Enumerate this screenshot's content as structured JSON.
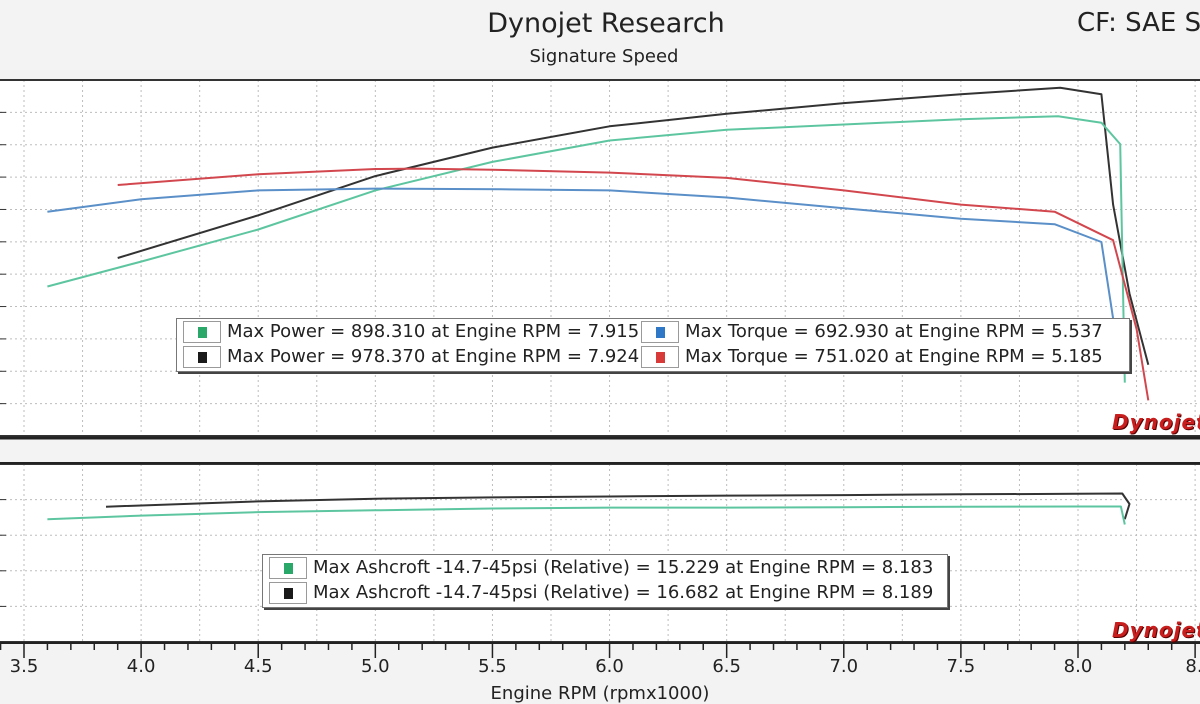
{
  "header": {
    "title": "Dynojet Research",
    "subtitle": "Signature Speed",
    "correction": "CF: SAE S"
  },
  "logo_text": "Dynojet",
  "colors": {
    "green": "#2aa86a",
    "black": "#1a1a1a",
    "blue": "#2f78c8",
    "red": "#d83a3a",
    "green_line": "#5dc6a0",
    "black_line": "#333333",
    "blue_line": "#5a8fc8",
    "red_line": "#d2474e"
  },
  "legend_top": {
    "left": [
      {
        "text": "Max Power = 898.310 at Engine RPM = 7.915",
        "color": "green"
      },
      {
        "text": "Max Power = 978.370 at Engine RPM = 7.924",
        "color": "black"
      }
    ],
    "right": [
      {
        "text": "Max Torque = 692.930 at Engine RPM = 5.537",
        "color": "blue"
      },
      {
        "text": "Max Torque = 751.020 at Engine RPM = 5.185",
        "color": "red"
      }
    ]
  },
  "legend_bottom": {
    "rows": [
      {
        "text": "Max Ashcroft -14.7-45psi (Relative) = 15.229 at Engine RPM = 8.183",
        "color": "green"
      },
      {
        "text": "Max Ashcroft -14.7-45psi (Relative) = 16.682 at Engine RPM = 8.189",
        "color": "black"
      }
    ]
  },
  "chart_data": {
    "type": "line",
    "xlabel": "Engine RPM (rpmx1000)",
    "x_ticks": [
      "3.5",
      "4.0",
      "4.5",
      "5.0",
      "5.5",
      "6.0",
      "6.5",
      "7.0",
      "7.5",
      "8.0",
      "8."
    ],
    "xlim": [
      3.4,
      8.5
    ],
    "grid": true,
    "panels": [
      {
        "name": "power_torque",
        "ylim": [
          0,
          1000
        ],
        "series": [
          {
            "color": "black",
            "x": [
              3.9,
              4.5,
              5.0,
              5.5,
              6.0,
              6.5,
              7.0,
              7.5,
              7.924,
              8.1,
              8.15,
              8.22,
              8.3
            ],
            "y": [
              500,
              620,
              730,
              810,
              870,
              905,
              935,
              960,
              978,
              960,
              650,
              400,
              200
            ]
          },
          {
            "color": "green",
            "x": [
              3.6,
              4.0,
              4.5,
              5.0,
              5.5,
              6.0,
              6.5,
              7.0,
              7.5,
              7.915,
              8.1,
              8.18,
              8.2
            ],
            "y": [
              420,
              490,
              580,
              690,
              770,
              830,
              860,
              875,
              890,
              898,
              880,
              820,
              150
            ]
          },
          {
            "color": "red",
            "x": [
              3.9,
              4.5,
              5.0,
              5.185,
              5.5,
              6.0,
              6.5,
              7.0,
              7.5,
              7.9,
              8.15,
              8.25,
              8.3
            ],
            "y": [
              705,
              735,
              750,
              751,
              748,
              740,
              725,
              690,
              650,
              630,
              550,
              300,
              100
            ]
          },
          {
            "color": "blue",
            "x": [
              3.6,
              4.0,
              4.5,
              5.0,
              5.537,
              6.0,
              6.5,
              7.0,
              7.5,
              7.9,
              8.1,
              8.18
            ],
            "y": [
              630,
              665,
              690,
              695,
              693,
              690,
              670,
              640,
              610,
              595,
              545,
              200
            ]
          }
        ]
      },
      {
        "name": "boost",
        "ylim": [
          0,
          20
        ],
        "series": [
          {
            "color": "black",
            "x": [
              3.85,
              4.5,
              5.0,
              5.5,
              6.0,
              6.5,
              7.0,
              7.5,
              8.0,
              8.189,
              8.22,
              8.2
            ],
            "y": [
              15.2,
              15.8,
              16.1,
              16.25,
              16.35,
              16.45,
              16.5,
              16.6,
              16.65,
              16.682,
              15.5,
              13.8
            ]
          },
          {
            "color": "green",
            "x": [
              3.6,
              4.0,
              4.5,
              5.0,
              5.5,
              6.0,
              6.5,
              7.0,
              7.5,
              8.0,
              8.183,
              8.2
            ],
            "y": [
              13.8,
              14.2,
              14.6,
              14.8,
              15.0,
              15.1,
              15.1,
              15.15,
              15.2,
              15.22,
              15.229,
              13.2
            ]
          }
        ]
      }
    ]
  }
}
